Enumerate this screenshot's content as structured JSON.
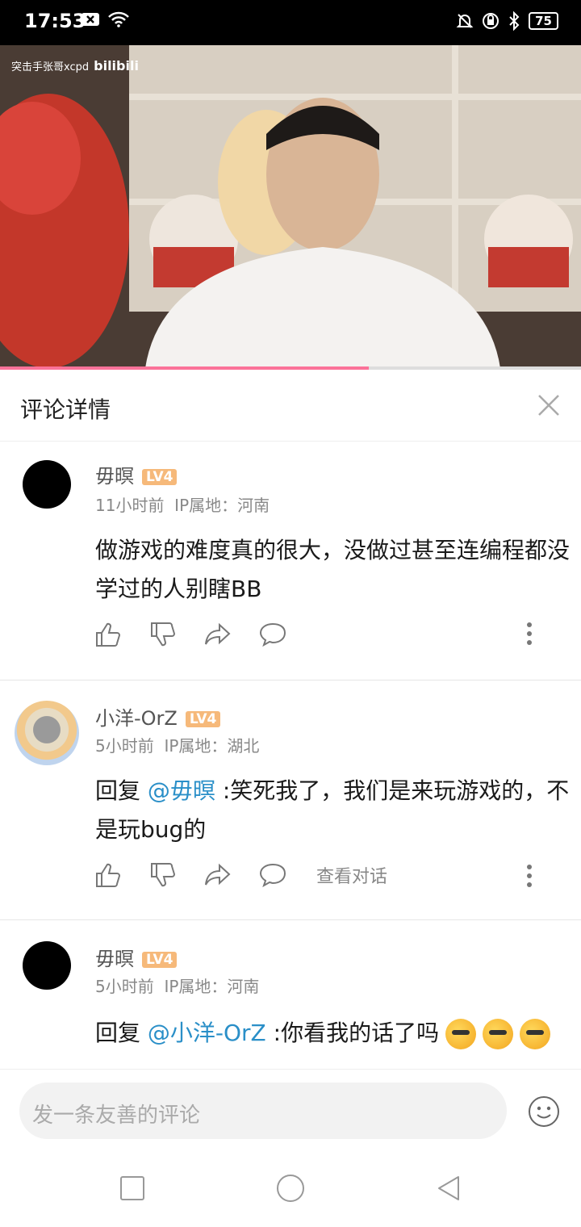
{
  "status_bar": {
    "time": "17:53",
    "battery": "75"
  },
  "video": {
    "watermark_text": "突击手张哥xcpd",
    "logo_text": "bilibili",
    "progress": 0.635
  },
  "header": {
    "title": "评论详情"
  },
  "comments": [
    {
      "user": "毋暝",
      "level": "LV4",
      "time": "11小时前",
      "ip": "IP属地：河南",
      "text": "做游戏的难度真的很大，没做过甚至连编程都没学过的人别瞎BB"
    },
    {
      "user": "小洋-OrZ",
      "level": "LV4",
      "time": "5小时前",
      "ip": "IP属地：湖北",
      "reply_prefix": "回复 ",
      "mention": "@毋暝",
      "text": " :笑死我了，我们是来玩游戏的，不是玩bug的",
      "view_conversation": "查看对话"
    },
    {
      "user": "毋暝",
      "level": "LV4",
      "time": "5小时前",
      "ip": "IP属地：河南",
      "reply_prefix": "回复 ",
      "mention": "@小洋-OrZ",
      "text": " :你看我的话了吗"
    }
  ],
  "input": {
    "placeholder": "发一条友善的评论"
  },
  "colors": {
    "accent": "#fb7299",
    "mention": "#2a8fc8",
    "level_badge": "#f6b97a"
  }
}
